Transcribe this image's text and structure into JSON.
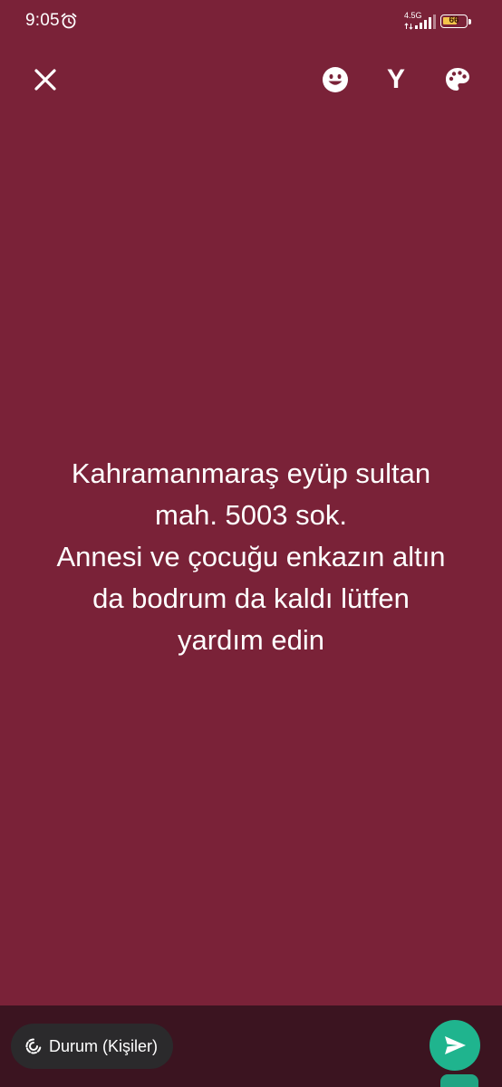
{
  "status_bar": {
    "time": "9:05",
    "network_label": "4.5G",
    "battery_level": "66",
    "battery_fraction": 0.66,
    "icons": [
      "alarm-clock-icon",
      "signal-icon",
      "battery-icon"
    ]
  },
  "toolbar": {
    "icons": [
      "close-icon",
      "emoji-icon",
      "font-icon",
      "palette-icon"
    ],
    "font_glyph": "Y"
  },
  "status": {
    "text": "Kahramanmaraş eyüp sultan\nmah. 5003 sok.\nAnnesi ve çocuğu enkazın altın\nda bodrum da kaldı lütfen\nyardım edin"
  },
  "footer": {
    "audience_label": "Durum (Kişiler)",
    "audience_icon": "status-ring-icon",
    "send_icon": "send-icon"
  },
  "colors": {
    "background": "#7a2238",
    "footer": "#3b1420",
    "chip": "#2b2a2c",
    "accent": "#1fb48e",
    "battery": "#f3c44b"
  }
}
